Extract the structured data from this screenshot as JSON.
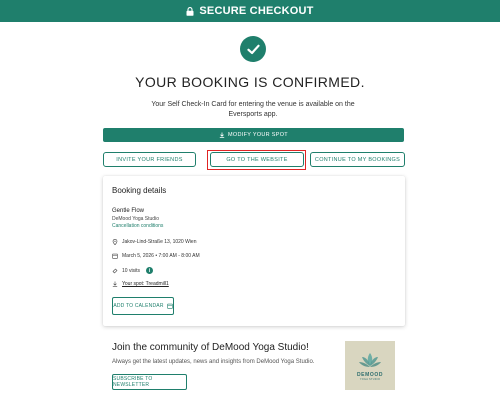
{
  "header": {
    "title": "SECURE CHECKOUT",
    "icon": "lock-icon",
    "bg_color": "#1f7f6c"
  },
  "confirmation": {
    "icon": "check-circle-icon",
    "headline": "YOUR BOOKING IS CONFIRMED.",
    "message": "Your Self Check-In Card for entering the venue is available on the Eversports app."
  },
  "actions": {
    "modify_label": "MODIFY YOUR SPOT",
    "invite_label": "INVITE YOUR FRIENDS",
    "website_label": "GO TO THE WEBSITE",
    "bookings_label": "CONTINUE TO MY BOOKINGS"
  },
  "booking": {
    "section_title": "Booking details",
    "class_name": "Gentle Flow",
    "studio": "DeMood Yoga Studio",
    "cancellation_link": "Cancellation conditions",
    "address": "Jakov-Lind-Straße 13, 1020 Wien",
    "datetime": "March 5, 2026 • 7:00 AM - 8:00 AM",
    "visits": "10 visits",
    "spot": "Your spot: Treadmill1",
    "calendar_label": "ADD TO CALENDAR"
  },
  "community": {
    "title": "Join the community of DeMood Yoga Studio!",
    "subtitle": "Always get the latest updates, news and insights from DeMood Yoga Studio.",
    "newsletter_label": "SUBSCRIBE TO NEWSLETTER",
    "logo_text": "DEMOOD",
    "logo_subtext": "YOGA STUDIO"
  },
  "colors": {
    "accent": "#1f7f6c",
    "highlight": "#e02424",
    "logo_bg": "#d9d6c0"
  }
}
